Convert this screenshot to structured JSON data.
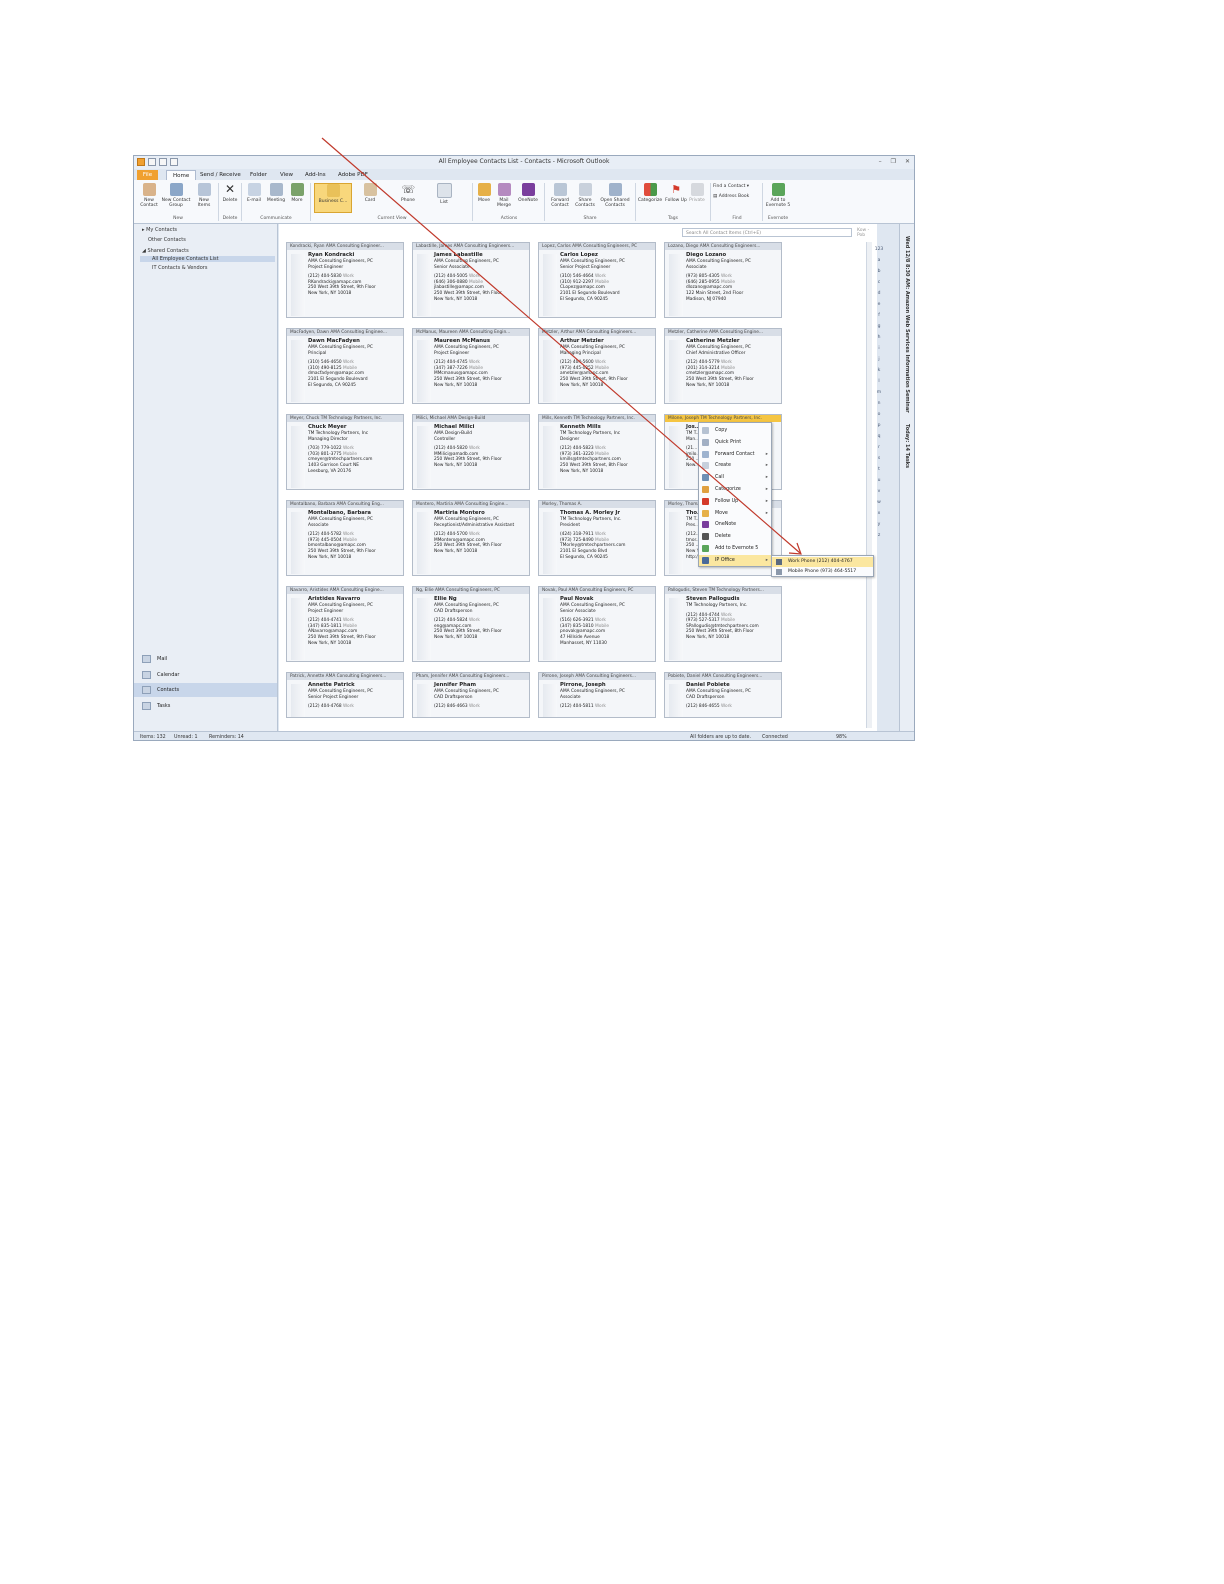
{
  "window": {
    "title": "All Employee Contacts List - Contacts - Microsoft Outlook"
  },
  "ribbon": {
    "tabs": [
      {
        "label": "File"
      },
      {
        "label": "Home"
      },
      {
        "label": "Send / Receive"
      },
      {
        "label": "Folder"
      },
      {
        "label": "View"
      },
      {
        "label": "Add-Ins"
      },
      {
        "label": "Adobe PDF"
      }
    ],
    "buttons": {
      "new_contact": "New Contact",
      "new_contact_group": "New Contact Group",
      "new_items": "New Items",
      "delete": "Delete",
      "email": "E-mail",
      "meeting": "Meeting",
      "more": "More",
      "business_card": "Business C...",
      "card": "Card",
      "phone": "Phone",
      "list": "List",
      "move": "Move",
      "mail_merge": "Mail Merge",
      "onenote": "OneNote",
      "forward_contact": "Forward Contact",
      "share_contacts": "Share Contacts",
      "open_shared": "Open Shared Contacts",
      "categorize": "Categorize",
      "follow_up": "Follow Up",
      "private": "Private",
      "find_contact": "Find a Contact",
      "address_book": "Address Book",
      "add_evernote": "Add to Evernote 5"
    },
    "groups": {
      "new": "New",
      "delete": "Delete",
      "communicate": "Communicate",
      "current_view": "Current View",
      "actions": "Actions",
      "share": "Share",
      "tags": "Tags",
      "find": "Find",
      "evernote": "Evernote"
    }
  },
  "nav": {
    "my_contacts": "My Contacts",
    "other_contacts": "Other Contacts",
    "shared_contacts": "Shared Contacts",
    "items": [
      "All Employee Contacts List",
      "IT Contacts & Vendors"
    ],
    "bottom": [
      "Mail",
      "Calendar",
      "Contacts",
      "Tasks"
    ]
  },
  "search": {
    "placeholder": "Search All Contact Items (Ctrl+E)",
    "range": "Kow - Pob"
  },
  "alpha_index": [
    "123",
    "a",
    "b",
    "c",
    "d",
    "e",
    "f",
    "g",
    "h",
    "i",
    "j",
    "k",
    "l",
    "m",
    "n",
    "o",
    "p",
    "q",
    "r",
    "s",
    "t",
    "u",
    "v",
    "w",
    "x",
    "y",
    "z"
  ],
  "cards": [
    {
      "header": "Kondracki, Ryan AMA Consulting Engineer...",
      "name": "Ryan Kondracki",
      "company": "AMA Consulting Engineers, PC",
      "title": "Project Engineer",
      "phone1": "(212) 404-5830",
      "phone1_label": "Work",
      "email": "RKondracki@amapc.com",
      "addr1": "250 West 39th Street, 9th Floor",
      "addr2": "New York, NY 10018"
    },
    {
      "header": "Labastille, James AMA Consulting Engineers...",
      "name": "James Labastille",
      "company": "AMA Consulting Engineers, PC",
      "title": "Senior Associate",
      "phone1": "(212) 404-5005",
      "phone1_label": "Work",
      "phone2": "(646) 306-0880",
      "phone2_label": "Mobile",
      "email": "jlabastille@amapc.com",
      "addr1": "250 West 39th Street, 9th Floor",
      "addr2": "New York, NY 10018"
    },
    {
      "header": "Lopez, Carlos AMA Consulting Engineers, PC",
      "name": "Carlos Lopez",
      "company": "AMA Consulting Engineers, PC",
      "title": "Senior Project Engineer",
      "phone1": "(310) 546-4664",
      "phone1_label": "Work",
      "phone2": "(310) 912-2297",
      "phone2_label": "Mobile",
      "email": "CLopez@amapc.com",
      "addr1": "2101 El Segundo Boulevard",
      "addr2": "El Segundo, CA 90245"
    },
    {
      "header": "Lozano, Diego AMA Consulting Engineers...",
      "name": "Diego Lozano",
      "company": "AMA Consulting Engineers, PC",
      "title": "Associate",
      "phone1": "(973) 805-4305",
      "phone1_label": "Work",
      "phone2": "(646) 285-0955",
      "phone2_label": "Mobile",
      "email": "dlozano@amapc.com",
      "addr1": "122 Main Street, 2nd Floor",
      "addr2": "Madison, NJ 07940"
    },
    {
      "header": "MacFadyen, Dawn AMA Consulting Enginee...",
      "name": "Dawn MacFadyen",
      "company": "AMA Consulting Engineers, PC",
      "title": "Principal",
      "phone1": "(310) 546-4650",
      "phone1_label": "Work",
      "phone2": "(310) 490-8125",
      "phone2_label": "Mobile",
      "email": "dmacfadyen@amapc.com",
      "addr1": "2101 El Segundo Boulevard",
      "addr2": "El Segundo, CA 90245"
    },
    {
      "header": "McManus, Maureen AMA Consulting Engin...",
      "name": "Maureen McManus",
      "company": "AMA Consulting Engineers, PC",
      "title": "Project Engineer",
      "phone1": "(212) 404-4745",
      "phone1_label": "Work",
      "phone2": "(347) 387-7226",
      "phone2_label": "Mobile",
      "email": "MMcmanus@amapc.com",
      "addr1": "250 West 39th Street, 9th Floor",
      "addr2": "New York, NY 10018"
    },
    {
      "header": "Metzler, Arthur AMA Consulting Engineers...",
      "name": "Arthur Metzler",
      "company": "AMA Consulting Engineers, PC",
      "title": "Managing Principal",
      "phone1": "(212) 404-5600",
      "phone1_label": "Work",
      "phone2": "(973) 445-0252",
      "phone2_label": "Mobile",
      "email": "ametzler@amapc.com",
      "addr1": "250 West 39th Street, 9th Floor",
      "addr2": "New York, NY 10018"
    },
    {
      "header": "Metzler, Catherine AMA Consulting Engine...",
      "name": "Catherine Metzler",
      "company": "AMA Consulting Engineers, PC",
      "title": "Chief Administrative Officer",
      "phone1": "(212) 404-5779",
      "phone1_label": "Work",
      "phone2": "(201) 314-3214",
      "phone2_label": "Mobile",
      "email": "cmetzler@amapc.com",
      "addr1": "250 West 39th Street, 9th Floor",
      "addr2": "New York, NY 10018"
    },
    {
      "header": "Meyer, Chuck TM Technology Partners, Inc.",
      "name": "Chuck Meyer",
      "company": "TM Technology Partners, Inc",
      "title": "Managing Director",
      "phone1": "(703) 779-1022",
      "phone1_label": "Work",
      "phone2": "(703) 801-3775",
      "phone2_label": "Mobile",
      "email": "cmeyer@tmtechpartners.com",
      "addr1": "1403 Garrison Court NE",
      "addr2": "Leesburg, VA 20176"
    },
    {
      "header": "Milici, Michael AMA Design-Build",
      "name": "Michael Milici",
      "company": "AMA Design-Build",
      "title": "Controller",
      "phone1": "(212) 404-5820",
      "phone1_label": "Work",
      "email": "MMilici@amadb.com",
      "addr1": "250 West 39th Street, 9th Floor",
      "addr2": "New York, NY 10018"
    },
    {
      "header": "Mills, Kenneth TM Technology Partners, Inc.",
      "name": "Kenneth Mills",
      "company": "TM Technology Partners, Inc",
      "title": "Designer",
      "phone1": "(212) 404-5823",
      "phone1_label": "Work",
      "phone2": "(973) 361-3220",
      "phone2_label": "Mobile",
      "email": "kmills@tmtechpartners.com",
      "addr1": "250 West 39th Street, 8th Floor",
      "addr2": "New York, NY 10018"
    },
    {
      "header": "Milone, Joseph TM Technology Partners, Inc.",
      "name": "Jos...",
      "company": "TM T...",
      "title": "Man...",
      "phone1": "(21...",
      "email": "jmilo...",
      "addr1": "250 ...",
      "addr2": "New..."
    },
    {
      "header": "Montalbano, Barbara AMA Consulting Eng...",
      "name": "Montalbano, Barbara",
      "company": "AMA Consulting Engineers, PC",
      "title": "Associate",
      "phone1": "(212) 404-5782",
      "phone1_label": "Work",
      "phone2": "(973) 445-0504",
      "phone2_label": "Mobile",
      "email": "bmontalbano@amapc.com",
      "addr1": "250 West 39th Street, 9th Floor",
      "addr2": "New York, NY 10018"
    },
    {
      "header": "Montero, Martiria AMA Consulting Engine...",
      "name": "Martiria Montero",
      "company": "AMA Consulting Engineers, PC",
      "title": "Receptionist/Administrative Assistant",
      "phone1": "(212) 404-5700",
      "phone1_label": "Work",
      "email": "MMontero@amapc.com",
      "addr1": "250 West 39th Street, 9th Floor",
      "addr2": "New York, NY 10018"
    },
    {
      "header": "Morley, Thomas A.",
      "name": "Thomas A. Morley Jr",
      "company": "TM Technology Partners, Inc.",
      "title": "President",
      "phone1": "(424) 318-7911",
      "phone1_label": "Work",
      "phone2": "(973) 725-8490",
      "phone2_label": "Mobile",
      "email": "TMorley@tmtechpartners.com",
      "addr1": "2101 El Segundo Blvd",
      "addr2": "El Segundo, CA 90245"
    },
    {
      "header": "Morley, Thomas A.",
      "name": "Tho...",
      "company": "TM T...",
      "title": "Pres...",
      "phone1": "(212...",
      "email": "tmor...",
      "addr1": "250 ...",
      "addr2": "New York, NY 10018",
      "web": "http://www.tmtechpartners.com"
    },
    {
      "header": "Navarro, Aristides AMA Consulting Engine...",
      "name": "Aristides Navarro",
      "company": "AMA Consulting Engineers, PC",
      "title": "Project Engineer",
      "phone1": "(212) 404-4741",
      "phone1_label": "Work",
      "phone2": "(347) 835-1811",
      "phone2_label": "Mobile",
      "email": "ANavarro@amapc.com",
      "addr1": "250 West 39th Street, 9th Floor",
      "addr2": "New York, NY 10018"
    },
    {
      "header": "Ng, Ellie AMA Consulting Engineers, PC",
      "name": "Ellie Ng",
      "company": "AMA Consulting Engineers, PC",
      "title": "CAD Draftsperson",
      "phone1": "(212) 404-5824",
      "phone1_label": "Work",
      "email": "eng@amapc.com",
      "addr1": "250 West 39th Street, 9th Floor",
      "addr2": "New York, NY 10018"
    },
    {
      "header": "Novak, Paul AMA Consulting Engineers, PC",
      "name": "Paul Novak",
      "company": "AMA Consulting Engineers, PC",
      "title": "Senior Associate",
      "phone1": "(516) 626-3921",
      "phone1_label": "Work",
      "phone2": "(347) 835-1810",
      "phone2_label": "Mobile",
      "email": "pnovak@amapc.com",
      "addr1": "47 Hillside Avenue",
      "addr2": "Manhasset, NY 11030"
    },
    {
      "header": "Pallogudis, Steven TM Technology Partners...",
      "name": "Steven Pallogudis",
      "company": "TM Technology Partners, Inc.",
      "title": "",
      "phone1": "(212) 404-4744",
      "phone1_label": "Work",
      "phone2": "(973) 527-5317",
      "phone2_label": "Mobile",
      "email": "SPallogudis@tmtechpartners.com",
      "addr1": "250 West 39th Street, 8th Floor",
      "addr2": "New York, NY 10018"
    },
    {
      "header": "Patrick, Annette AMA Consulting Engineers...",
      "name": "Annette Patrick",
      "company": "AMA Consulting Engineers, PC",
      "title": "Senior Project Engineer",
      "phone1": "(212) 404-4768",
      "phone1_label": "Work"
    },
    {
      "header": "Pham, Jennifer AMA Consulting Engineers...",
      "name": "Jennifer Pham",
      "company": "AMA Consulting Engineers, PC",
      "title": "CAD Draftsperson",
      "phone1": "(212) 846-4663",
      "phone1_label": "Work"
    },
    {
      "header": "Pirrone, Joseph AMA Consulting Engineers...",
      "name": "Pirrone, Joseph",
      "company": "AMA Consulting Engineers, PC",
      "title": "Associate",
      "phone1": "(212) 404-5811",
      "phone1_label": "Work"
    },
    {
      "header": "Pobiete, Daniel AMA Consulting Engineers...",
      "name": "Daniel Pobiete",
      "company": "AMA Consulting Engineers, PC",
      "title": "CAD Draftsperson",
      "phone1": "(212) 846-4655",
      "phone1_label": "Work"
    }
  ],
  "context_menu": {
    "items": [
      {
        "label": "Copy",
        "arrow": ""
      },
      {
        "label": "Quick Print",
        "arrow": ""
      },
      {
        "label": "Forward Contact",
        "arrow": "▸"
      },
      {
        "label": "Create",
        "arrow": "▸"
      },
      {
        "label": "Call",
        "arrow": "▸"
      },
      {
        "label": "Categorize",
        "arrow": "▸"
      },
      {
        "label": "Follow Up",
        "arrow": "▸"
      },
      {
        "label": "Move",
        "arrow": "▸"
      },
      {
        "label": "OneNote",
        "arrow": ""
      },
      {
        "label": "Delete",
        "arrow": ""
      },
      {
        "label": "Add to Evernote 5",
        "arrow": ""
      },
      {
        "label": "IP Office",
        "arrow": "▸"
      }
    ],
    "submenu": [
      "Work Phone (212) 404-4767",
      "Mobile Phone (973) 464-5517"
    ]
  },
  "todo_bar": {
    "label1": "Wed 12/8 8:30 AM: Amazon Web Services Information Seminar",
    "label2": "Today: 14 Tasks"
  },
  "status": {
    "items": "Items: 132",
    "unread": "Unread: 1",
    "reminders": "Reminders: 14",
    "sync": "All folders are up to date.",
    "connection": "Connected",
    "zoom": "98%"
  }
}
